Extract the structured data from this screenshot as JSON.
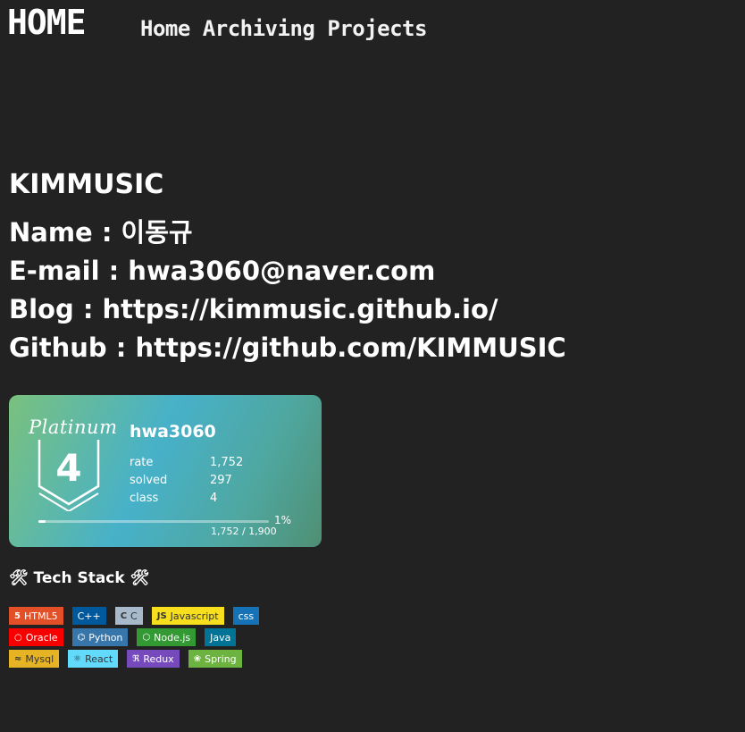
{
  "nav": {
    "logo": "HOME",
    "links": [
      "Home",
      "Archiving",
      "Projects"
    ]
  },
  "main": {
    "title": "KIMMUSIC",
    "info": [
      "Name : 이동규",
      "E-mail : hwa3060@naver.com",
      "Blog : https://kimmusic.github.io/",
      "Github : https://github.com/KIMMUSIC"
    ]
  },
  "badge": {
    "tier": "Platinum",
    "tier_level": "4",
    "handle": "hwa3060",
    "stats": [
      {
        "key": "rate",
        "value": "1,752"
      },
      {
        "key": "solved",
        "value": "297"
      },
      {
        "key": "class",
        "value": "4"
      }
    ],
    "progress_percent": "1%",
    "progress_fraction": 0.01,
    "progress_text": "1,752 / 1,900"
  },
  "stack": {
    "title": "🛠 Tech Stack 🛠",
    "rows": [
      [
        {
          "label": "HTML5",
          "icon": "html5-icon",
          "color": "#e34f26",
          "text_color": "#ffffff"
        },
        {
          "label": "C++",
          "icon": "",
          "color": "#00599c",
          "text_color": "#ffffff"
        },
        {
          "label": "C",
          "icon": "c-icon",
          "color": "#a8b9cc",
          "text_color": "#333333"
        },
        {
          "label": "Javascript",
          "icon": "js-icon",
          "color": "#f7df1e",
          "text_color": "#333333"
        },
        {
          "label": "css",
          "icon": "",
          "color": "#1572b6",
          "text_color": "#ffffff"
        }
      ],
      [
        {
          "label": "Oracle",
          "icon": "oracle-icon",
          "color": "#f80000",
          "text_color": "#ffffff"
        },
        {
          "label": "Python",
          "icon": "python-icon",
          "color": "#3776ab",
          "text_color": "#ffffff"
        },
        {
          "label": "Node.js",
          "icon": "nodejs-icon",
          "color": "#339933",
          "text_color": "#ffffff"
        },
        {
          "label": "Java",
          "icon": "",
          "color": "#007396",
          "text_color": "#ffffff"
        }
      ],
      [
        {
          "label": "Mysql",
          "icon": "mysql-icon",
          "color": "#e6b324",
          "text_color": "#333333"
        },
        {
          "label": "React",
          "icon": "react-icon",
          "color": "#61dafb",
          "text_color": "#333333"
        },
        {
          "label": "Redux",
          "icon": "redux-icon",
          "color": "#764abc",
          "text_color": "#ffffff"
        },
        {
          "label": "Spring",
          "icon": "spring-icon",
          "color": "#6db33f",
          "text_color": "#ffffff"
        }
      ]
    ]
  }
}
